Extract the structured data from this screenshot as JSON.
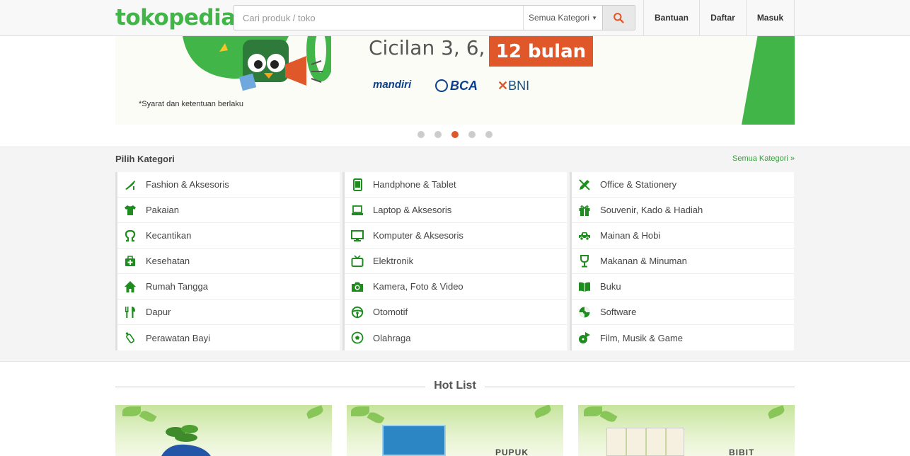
{
  "header": {
    "logo": "tokopedia",
    "search": {
      "placeholder": "Cari produk / toko",
      "value": ""
    },
    "category_select": "Semua Kategori",
    "nav": [
      "Bantuan",
      "Daftar",
      "Masuk"
    ]
  },
  "banner": {
    "headline": "Cicilan 3, 6,",
    "highlight": "12 bulan",
    "banks": [
      "mandiri",
      "BCA",
      "BNI"
    ],
    "note": "*Syarat dan ketentuan berlaku",
    "carousel": {
      "count": 5,
      "active": 3
    }
  },
  "categories": {
    "title": "Pilih Kategori",
    "all_link": "Semua Kategori »",
    "columns": [
      [
        {
          "label": "Fashion & Aksesoris",
          "icon": "heel-icon"
        },
        {
          "label": "Pakaian",
          "icon": "shirt-icon"
        },
        {
          "label": "Kecantikan",
          "icon": "beauty-icon"
        },
        {
          "label": "Kesehatan",
          "icon": "medkit-icon"
        },
        {
          "label": "Rumah Tangga",
          "icon": "house-icon"
        },
        {
          "label": "Dapur",
          "icon": "cutlery-icon"
        },
        {
          "label": "Perawatan Bayi",
          "icon": "bottle-icon"
        }
      ],
      [
        {
          "label": "Handphone & Tablet",
          "icon": "phone-icon"
        },
        {
          "label": "Laptop & Aksesoris",
          "icon": "laptop-icon"
        },
        {
          "label": "Komputer & Aksesoris",
          "icon": "monitor-icon"
        },
        {
          "label": "Elektronik",
          "icon": "tv-icon"
        },
        {
          "label": "Kamera, Foto & Video",
          "icon": "camera-icon"
        },
        {
          "label": "Otomotif",
          "icon": "steering-wheel-icon"
        },
        {
          "label": "Olahraga",
          "icon": "ball-icon"
        }
      ],
      [
        {
          "label": "Office & Stationery",
          "icon": "pencil-icon"
        },
        {
          "label": "Souvenir, Kado & Hadiah",
          "icon": "gift-icon"
        },
        {
          "label": "Mainan & Hobi",
          "icon": "toy-car-icon"
        },
        {
          "label": "Makanan & Minuman",
          "icon": "glass-icon"
        },
        {
          "label": "Buku",
          "icon": "book-icon"
        },
        {
          "label": "Software",
          "icon": "disc-icon"
        },
        {
          "label": "Film, Musik & Game",
          "icon": "media-icon"
        }
      ]
    ]
  },
  "hot_list": {
    "title": "Hot List",
    "cards": [
      {
        "name": "hot-card-1",
        "caption": ""
      },
      {
        "name": "hot-card-2",
        "caption": "PUPUK"
      },
      {
        "name": "hot-card-3",
        "caption": "BIBIT"
      }
    ]
  },
  "colors": {
    "brand_green": "#42b549",
    "icon_green": "#1e8c1e",
    "accent_orange": "#e0582a",
    "search_icon": "#e0582a"
  }
}
